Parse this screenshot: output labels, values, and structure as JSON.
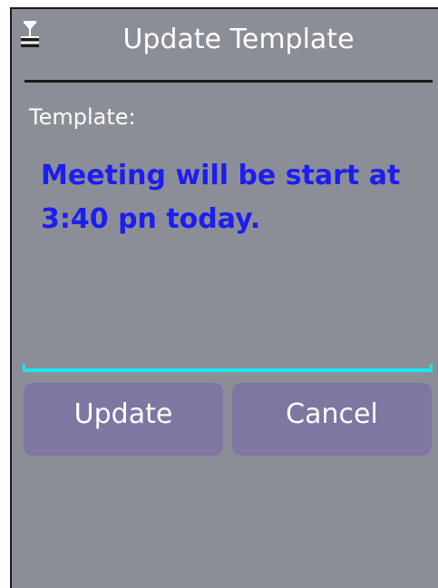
{
  "dialog": {
    "title": "Update Template",
    "icon": "antenna-signal-icon"
  },
  "form": {
    "label": "Template:",
    "value": "Meeting will be start at\n3:40 pn today."
  },
  "buttons": {
    "update_label": "Update",
    "cancel_label": "Cancel"
  },
  "colors": {
    "background": "#8b8e96",
    "text_value": "#1d1df0",
    "focus_line": "#1ce6f0",
    "button": "#7f76a2"
  }
}
